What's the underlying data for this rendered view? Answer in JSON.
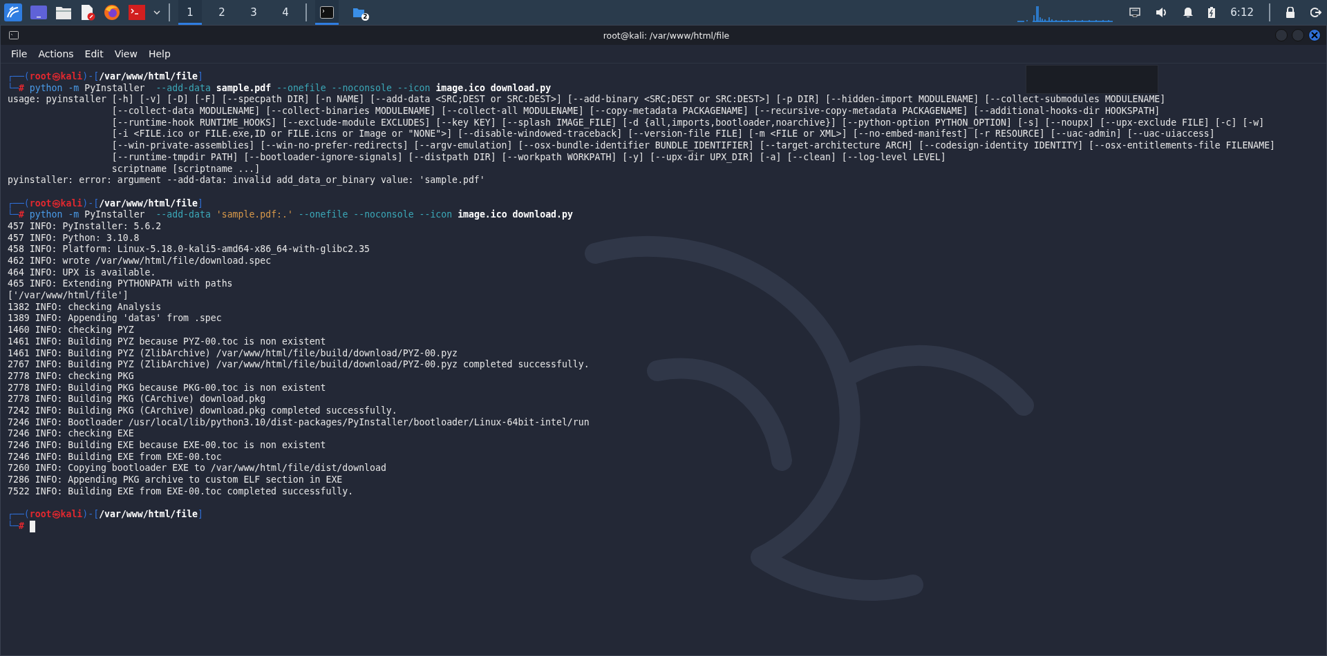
{
  "taskbar": {
    "launchers": [
      {
        "kind": "kali"
      },
      {
        "kind": "desktop"
      },
      {
        "kind": "files"
      },
      {
        "kind": "editor"
      },
      {
        "kind": "browser"
      },
      {
        "kind": "terminal"
      },
      {
        "kind": "dropdown"
      }
    ],
    "workspaces": [
      {
        "label": "1",
        "selected": true
      },
      {
        "label": "2",
        "selected": false
      },
      {
        "label": "3",
        "selected": false
      },
      {
        "label": "4",
        "selected": false
      }
    ],
    "tasks": [
      {
        "kind": "terminal",
        "selected": true
      },
      {
        "kind": "folder",
        "selected": false,
        "badge": "2"
      }
    ],
    "tray": [
      {
        "kind": "network"
      },
      {
        "kind": "volume"
      },
      {
        "kind": "bell"
      },
      {
        "kind": "battery"
      }
    ],
    "clock": "6:12",
    "session": [
      {
        "kind": "lock"
      },
      {
        "kind": "logout"
      }
    ]
  },
  "window": {
    "title": "root@kali: /var/www/html/file",
    "menu": [
      "File",
      "Actions",
      "Edit",
      "View",
      "Help"
    ]
  },
  "terminal": {
    "blocks": [
      {
        "prompt": {
          "top": [
            {
              "kind": "frame",
              "text": "┌──("
            },
            {
              "kind": "user",
              "text": "root㉿kali"
            },
            {
              "kind": "frame",
              "text": ")-["
            },
            {
              "kind": "path",
              "text": "/var/www/html/file"
            },
            {
              "kind": "frame",
              "text": "]"
            }
          ],
          "bottom": [
            {
              "kind": "frame",
              "text": "└─"
            },
            {
              "kind": "hash",
              "text": "#"
            }
          ]
        },
        "command": [
          {
            "kind": "cmd",
            "text": "python"
          },
          {
            "kind": "cmd",
            "text": " -m"
          },
          {
            "kind": "text",
            "text": " PyInstaller  "
          },
          {
            "kind": "flag",
            "text": "--add-data"
          },
          {
            "kind": "arg",
            "text": " sample.pdf"
          },
          {
            "kind": "flag",
            "text": " --onefile"
          },
          {
            "kind": "flag",
            "text": " --noconsole"
          },
          {
            "kind": "flag",
            "text": " --icon"
          },
          {
            "kind": "arg",
            "text": " image.ico"
          },
          {
            "kind": "arg",
            "text": " download.py"
          }
        ],
        "cursor": false,
        "output": [
          "usage: pyinstaller [-h] [-v] [-D] [-F] [--specpath DIR] [-n NAME] [--add-data <SRC;DEST or SRC:DEST>] [--add-binary <SRC;DEST or SRC:DEST>] [-p DIR] [--hidden-import MODULENAME] [--collect-submodules MODULENAME]",
          "                   [--collect-data MODULENAME] [--collect-binaries MODULENAME] [--collect-all MODULENAME] [--copy-metadata PACKAGENAME] [--recursive-copy-metadata PACKAGENAME] [--additional-hooks-dir HOOKSPATH]",
          "                   [--runtime-hook RUNTIME_HOOKS] [--exclude-module EXCLUDES] [--key KEY] [--splash IMAGE_FILE] [-d {all,imports,bootloader,noarchive}] [--python-option PYTHON_OPTION] [-s] [--noupx] [--upx-exclude FILE] [-c] [-w]",
          "                   [-i <FILE.ico or FILE.exe,ID or FILE.icns or Image or \"NONE\">] [--disable-windowed-traceback] [--version-file FILE] [-m <FILE or XML>] [--no-embed-manifest] [-r RESOURCE] [--uac-admin] [--uac-uiaccess]",
          "                   [--win-private-assemblies] [--win-no-prefer-redirects] [--argv-emulation] [--osx-bundle-identifier BUNDLE_IDENTIFIER] [--target-architecture ARCH] [--codesign-identity IDENTITY] [--osx-entitlements-file FILENAME]",
          "                   [--runtime-tmpdir PATH] [--bootloader-ignore-signals] [--distpath DIR] [--workpath WORKPATH] [-y] [--upx-dir UPX_DIR] [-a] [--clean] [--log-level LEVEL]",
          "                   scriptname [scriptname ...]",
          "pyinstaller: error: argument --add-data: invalid add_data_or_binary value: 'sample.pdf'"
        ]
      },
      {
        "prompt": {
          "top": [
            {
              "kind": "frame",
              "text": "┌──("
            },
            {
              "kind": "user",
              "text": "root㉿kali"
            },
            {
              "kind": "frame",
              "text": ")-["
            },
            {
              "kind": "path",
              "text": "/var/www/html/file"
            },
            {
              "kind": "frame",
              "text": "]"
            }
          ],
          "bottom": [
            {
              "kind": "frame",
              "text": "└─"
            },
            {
              "kind": "hash",
              "text": "#"
            }
          ]
        },
        "command": [
          {
            "kind": "cmd",
            "text": "python"
          },
          {
            "kind": "cmd",
            "text": " -m"
          },
          {
            "kind": "text",
            "text": " PyInstaller  "
          },
          {
            "kind": "flag",
            "text": "--add-data"
          },
          {
            "kind": "string",
            "text": " 'sample.pdf:.'"
          },
          {
            "kind": "flag",
            "text": " --onefile"
          },
          {
            "kind": "flag",
            "text": " --noconsole"
          },
          {
            "kind": "flag",
            "text": " --icon"
          },
          {
            "kind": "arg",
            "text": " image.ico"
          },
          {
            "kind": "arg",
            "text": " download.py"
          }
        ],
        "cursor": false,
        "output": [
          "457 INFO: PyInstaller: 5.6.2",
          "457 INFO: Python: 3.10.8",
          "458 INFO: Platform: Linux-5.18.0-kali5-amd64-x86_64-with-glibc2.35",
          "462 INFO: wrote /var/www/html/file/download.spec",
          "464 INFO: UPX is available.",
          "465 INFO: Extending PYTHONPATH with paths",
          "['/var/www/html/file']",
          "1382 INFO: checking Analysis",
          "1389 INFO: Appending 'datas' from .spec",
          "1460 INFO: checking PYZ",
          "1461 INFO: Building PYZ because PYZ-00.toc is non existent",
          "1461 INFO: Building PYZ (ZlibArchive) /var/www/html/file/build/download/PYZ-00.pyz",
          "2767 INFO: Building PYZ (ZlibArchive) /var/www/html/file/build/download/PYZ-00.pyz completed successfully.",
          "2778 INFO: checking PKG",
          "2778 INFO: Building PKG because PKG-00.toc is non existent",
          "2778 INFO: Building PKG (CArchive) download.pkg",
          "7242 INFO: Building PKG (CArchive) download.pkg completed successfully.",
          "7246 INFO: Bootloader /usr/local/lib/python3.10/dist-packages/PyInstaller/bootloader/Linux-64bit-intel/run",
          "7246 INFO: checking EXE",
          "7246 INFO: Building EXE because EXE-00.toc is non existent",
          "7246 INFO: Building EXE from EXE-00.toc",
          "7260 INFO: Copying bootloader EXE to /var/www/html/file/dist/download",
          "7286 INFO: Appending PKG archive to custom ELF section in EXE",
          "7522 INFO: Building EXE from EXE-00.toc completed successfully."
        ]
      },
      {
        "prompt": {
          "top": [
            {
              "kind": "frame",
              "text": "┌──("
            },
            {
              "kind": "user",
              "text": "root㉿kali"
            },
            {
              "kind": "frame",
              "text": ")-["
            },
            {
              "kind": "path",
              "text": "/var/www/html/file"
            },
            {
              "kind": "frame",
              "text": "]"
            }
          ],
          "bottom": [
            {
              "kind": "frame",
              "text": "└─"
            },
            {
              "kind": "hash",
              "text": "#"
            }
          ]
        },
        "cursor": true
      }
    ]
  }
}
